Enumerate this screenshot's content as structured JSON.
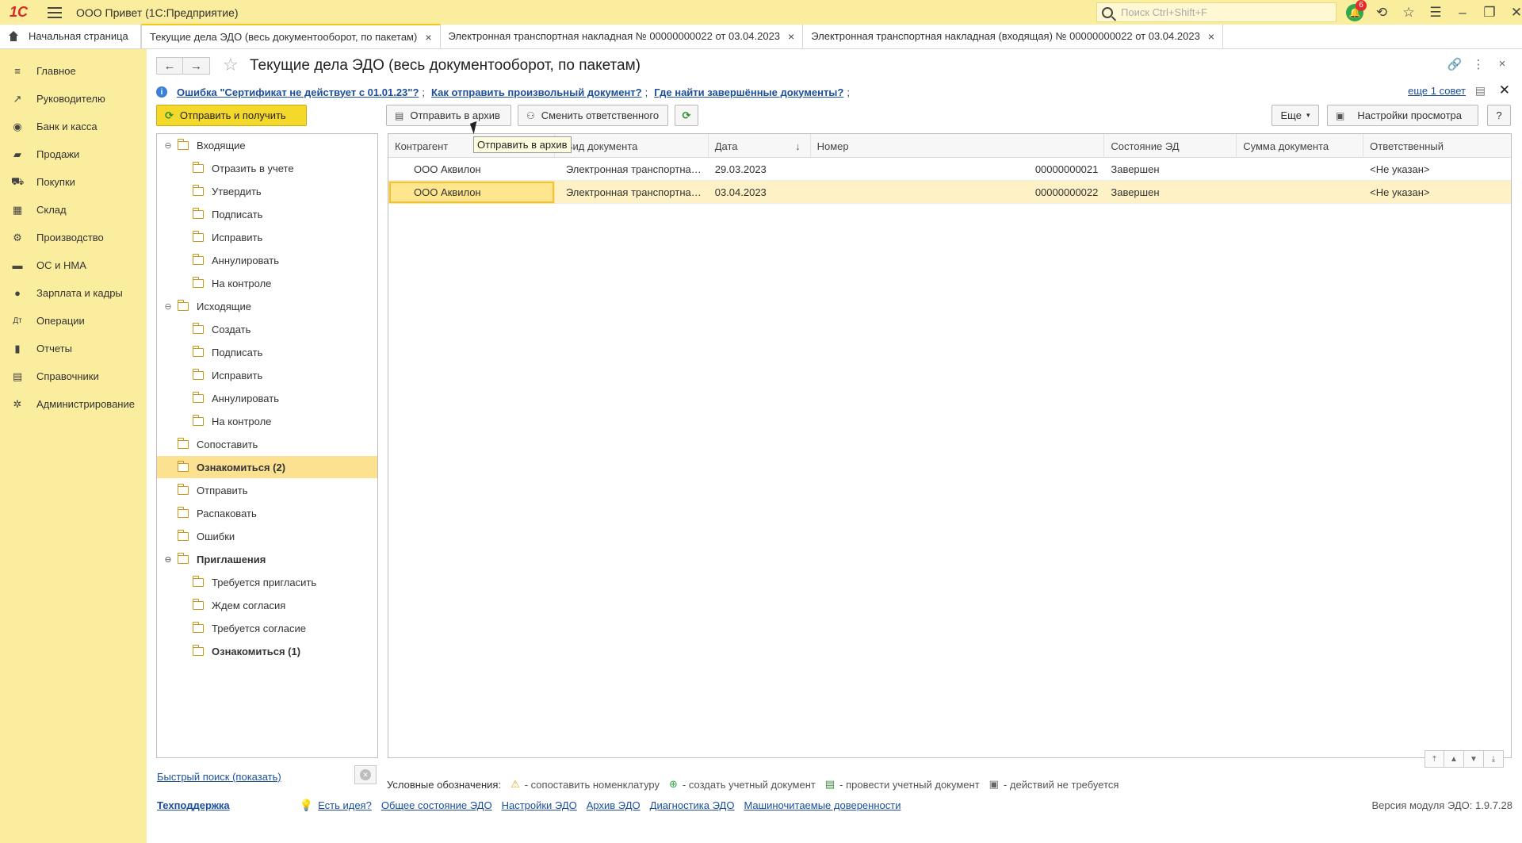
{
  "app": {
    "title": "ООО Привет  (1С:Предприятие)",
    "search_placeholder": "Поиск Ctrl+Shift+F",
    "notifications": "6"
  },
  "tabs": [
    {
      "label": "Начальная страница"
    },
    {
      "label": "Текущие дела ЭДО (весь документооборот, по пакетам)"
    },
    {
      "label": "Электронная транспортная накладная № 00000000022 от 03.04.2023"
    },
    {
      "label": "Электронная транспортная накладная (входящая) № 00000000022 от 03.04.2023"
    }
  ],
  "sections": [
    {
      "label": "Главное",
      "icon": "≡"
    },
    {
      "label": "Руководителю",
      "icon": "↗"
    },
    {
      "label": "Банк и касса",
      "icon": "◉"
    },
    {
      "label": "Продажи",
      "icon": "▰"
    },
    {
      "label": "Покупки",
      "icon": "⛟"
    },
    {
      "label": "Склад",
      "icon": "▦"
    },
    {
      "label": "Производство",
      "icon": "⚙"
    },
    {
      "label": "ОС и НМА",
      "icon": "▬"
    },
    {
      "label": "Зарплата и кадры",
      "icon": "●"
    },
    {
      "label": "Операции",
      "icon": "Дт"
    },
    {
      "label": "Отчеты",
      "icon": "▮"
    },
    {
      "label": "Справочники",
      "icon": "▤"
    },
    {
      "label": "Администрирование",
      "icon": "✲"
    }
  ],
  "page": {
    "title": "Текущие дела ЭДО (весь документооборот, по пакетам)"
  },
  "info": {
    "link1": "Ошибка \"Сертификат не действует с 01.01.23\"?",
    "link2": "Как отправить произвольный документ?",
    "link3": "Где найти завершённые документы?",
    "more": "еще 1 совет"
  },
  "toolbar": {
    "send_receive": "Отправить и получить",
    "archive": "Отправить в архив",
    "change_responsible": "Сменить ответственного",
    "more": "Еще",
    "view_settings": "Настройки просмотра",
    "help": "?",
    "tooltip": "Отправить в архив"
  },
  "tree": [
    {
      "label": "Входящие",
      "level": 0,
      "toggle": "⊖"
    },
    {
      "label": "Отразить в учете",
      "level": 1
    },
    {
      "label": "Утвердить",
      "level": 1
    },
    {
      "label": "Подписать",
      "level": 1
    },
    {
      "label": "Исправить",
      "level": 1
    },
    {
      "label": "Аннулировать",
      "level": 1
    },
    {
      "label": "На контроле",
      "level": 1
    },
    {
      "label": "Исходящие",
      "level": 0,
      "toggle": "⊖"
    },
    {
      "label": "Создать",
      "level": 1
    },
    {
      "label": "Подписать",
      "level": 1
    },
    {
      "label": "Исправить",
      "level": 1
    },
    {
      "label": "Аннулировать",
      "level": 1
    },
    {
      "label": "На контроле",
      "level": 1
    },
    {
      "label": "Сопоставить",
      "level": 0
    },
    {
      "label": "Ознакомиться (2)",
      "level": 0,
      "selected": true
    },
    {
      "label": "Отправить",
      "level": 0
    },
    {
      "label": "Распаковать",
      "level": 0
    },
    {
      "label": "Ошибки",
      "level": 0
    },
    {
      "label": "Приглашения",
      "level": 0,
      "toggle": "⊖",
      "bold": true
    },
    {
      "label": "Требуется пригласить",
      "level": 1
    },
    {
      "label": "Ждем согласия",
      "level": 1
    },
    {
      "label": "Требуется согласие",
      "level": 1
    },
    {
      "label": "Ознакомиться (1)",
      "level": 1,
      "bold": true
    }
  ],
  "table": {
    "columns": [
      "Контрагент",
      "Вид документа",
      "Дата",
      "Номер",
      "Состояние ЭД",
      "Сумма документа",
      "Ответственный"
    ],
    "rows": [
      [
        "ООО Аквилон",
        "Электронная транспортная накладная",
        "29.03.2023",
        "00000000021",
        "Завершен",
        "",
        "<Не указан>"
      ],
      [
        "ООО Аквилон",
        "Электронная транспортная накладная",
        "03.04.2023",
        "00000000022",
        "Завершен",
        "",
        "<Не указан>"
      ]
    ]
  },
  "bottom": {
    "quick_search": "Быстрый поиск (показать)",
    "legend_title": "Условные обозначения:",
    "legend": [
      {
        "sym": "⚠",
        "color": "#e3a51f",
        "text": "- сопоставить номенклатуру"
      },
      {
        "sym": "⊕",
        "color": "#2fa84f",
        "text": "- создать учетный документ"
      },
      {
        "sym": "▤",
        "color": "#3e8e3e",
        "text": "- провести учетный документ"
      },
      {
        "sym": "▣",
        "color": "#666666",
        "text": "- действий не требуется"
      }
    ],
    "support": "Техподдержка",
    "links": [
      "Есть идея?",
      "Общее состояние ЭДО",
      "Настройки ЭДО",
      "Архив ЭДО",
      "Диагностика ЭДО",
      "Машиночитаемые доверенности"
    ],
    "version": "Версия модуля ЭДО: 1.9.7.28"
  }
}
